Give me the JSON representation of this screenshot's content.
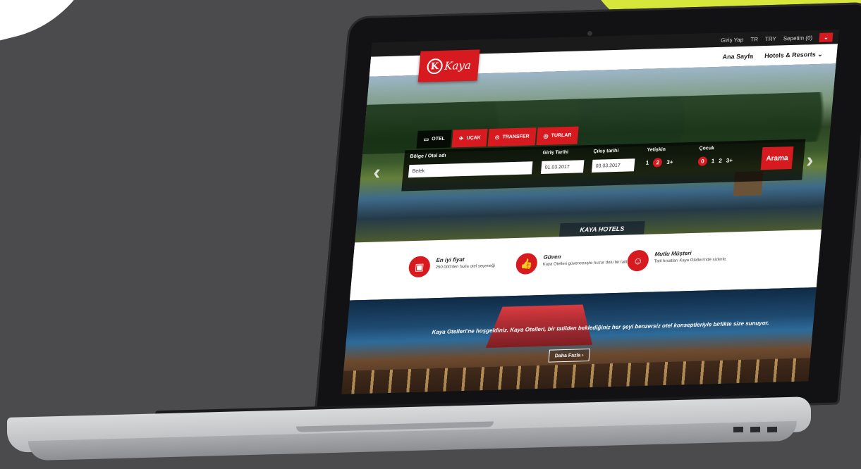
{
  "topbar": {
    "account_label": "Giriş Yap",
    "language_label": "TR",
    "currency_label": "TRY",
    "basket_label": "Sepetim (0)",
    "basket_icon": "chevron-down-icon"
  },
  "navbar": {
    "home_label": "Ana Sayfa",
    "hotels_label": "Hotels & Resorts"
  },
  "logo": {
    "mark": "K",
    "name": "Kaya"
  },
  "tabs": [
    {
      "label": "OTEL",
      "icon": "bed-icon"
    },
    {
      "label": "UÇAK",
      "icon": "plane-icon"
    },
    {
      "label": "TRANSFER",
      "icon": "car-icon"
    },
    {
      "label": "TURLAR",
      "icon": "compass-icon"
    }
  ],
  "search": {
    "destination_label": "Bölge / Otel adı",
    "destination_value": "Belek",
    "checkin_label": "Giriş Tarihi",
    "checkin_value": "01.03.2017",
    "checkout_label": "Çıkış tarihi",
    "checkout_value": "03.03.2017",
    "adult_label": "Yetişkin",
    "adult_options": [
      "1",
      "2",
      "3+"
    ],
    "adult_selected": "2",
    "child_label": "Çocuk",
    "child_options": [
      "0",
      "1",
      "2",
      "3+"
    ],
    "child_selected": "0",
    "button_label": "Arama"
  },
  "hero": {
    "caption": "KAYA HOTELS"
  },
  "features": [
    {
      "title": "En iyi fiyat",
      "desc": "250.000'den fazla otel seçeneği",
      "icon": "briefcase-icon"
    },
    {
      "title": "Güven",
      "desc": "Kaya Otelleri güvencesiyle huzur dolu bir tatil",
      "icon": "thumbs-up-icon"
    },
    {
      "title": "Mutlu Müşteri",
      "desc": "Tatil fırsatları Kaya Otelleri'nde sizlerle.",
      "icon": "smile-icon"
    }
  ],
  "banner": {
    "text": "Kaya Otelleri'ne hoşgeldiniz. Kaya Otelleri, bir tatilden beklediğiniz her şeyi benzersiz otel konseptleriyle birlikte size sunuyor.",
    "button_label": "Daha Fazla ›"
  },
  "colors": {
    "brand_red": "#d71920",
    "background": "#4b4b4d",
    "accent_lime": "#d7e63a"
  }
}
